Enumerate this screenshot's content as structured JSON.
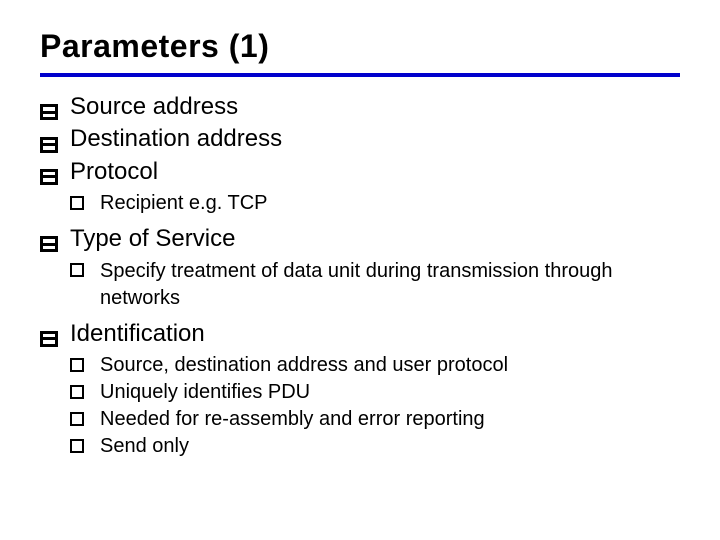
{
  "title": "Parameters (1)",
  "items": [
    {
      "text": "Source address"
    },
    {
      "text": "Destination address"
    },
    {
      "text": "Protocol",
      "sub": [
        {
          "text": "Recipient e.g. TCP"
        }
      ]
    },
    {
      "text": "Type of Service",
      "sub": [
        {
          "text": "Specify treatment of data unit during transmission through networks"
        }
      ]
    },
    {
      "text": "Identification",
      "sub": [
        {
          "text": "Source, destination address and user protocol"
        },
        {
          "text": "Uniquely identifies PDU"
        },
        {
          "text": "Needed for re-assembly and error reporting"
        },
        {
          "text": "Send only"
        }
      ]
    }
  ]
}
